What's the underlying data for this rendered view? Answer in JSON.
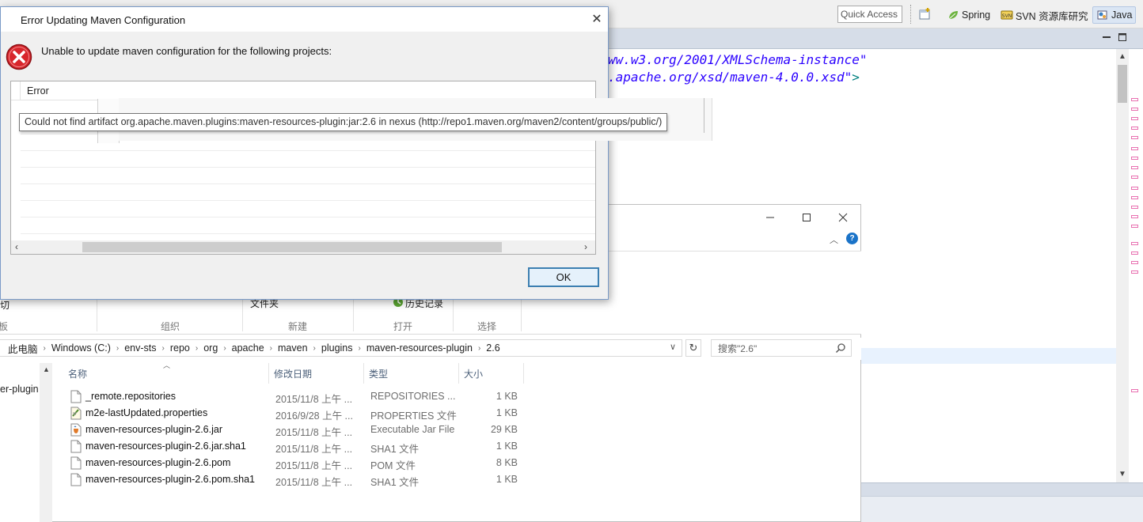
{
  "eclipse": {
    "quick_access": "Quick Access",
    "perspectives": [
      {
        "label": "Spring",
        "icon": "spring-leaf-icon"
      },
      {
        "label": "SVN 资源库研究",
        "icon": "svn-icon"
      },
      {
        "label": "Java",
        "icon": "java-icon",
        "active": true
      }
    ],
    "code_lines": [
      {
        "text": "ww.w3.org/2001/XMLSchema-instance\""
      },
      {
        "text": ".apache.org/xsd/maven-4.0.0.xsd\"",
        "bracket": ">"
      }
    ],
    "colors": {
      "code_string": "#2a00ff",
      "marker": "#e86fb0",
      "accent": "#1a73c8"
    }
  },
  "explorer": {
    "ribbon": {
      "partial_labels": [
        "剪切",
        "文件夹",
        "历史记录"
      ],
      "group_captions": [
        "板",
        "组织",
        "新建",
        "打开",
        "选择"
      ]
    },
    "address_crumbs": [
      "此电脑",
      "Windows (C:)",
      "env-sts",
      "repo",
      "org",
      "apache",
      "maven",
      "plugins",
      "maven-resources-plugin",
      "2.6"
    ],
    "search_placeholder": "搜索\"2.6\"",
    "nav_item": "er-plugin",
    "columns": {
      "name": "名称",
      "date": "修改日期",
      "type": "类型",
      "size": "大小"
    },
    "files": [
      {
        "name": "_remote.repositories",
        "date": "2015/11/8 上午 ...",
        "type": "REPOSITORIES ...",
        "size": "1 KB",
        "icon": "file-icon"
      },
      {
        "name": "m2e-lastUpdated.properties",
        "date": "2016/9/28 上午 ...",
        "type": "PROPERTIES 文件",
        "size": "1 KB",
        "icon": "properties-file-icon"
      },
      {
        "name": "maven-resources-plugin-2.6.jar",
        "date": "2015/11/8 上午 ...",
        "type": "Executable Jar File",
        "size": "29 KB",
        "icon": "jar-file-icon"
      },
      {
        "name": "maven-resources-plugin-2.6.jar.sha1",
        "date": "2015/11/8 上午 ...",
        "type": "SHA1 文件",
        "size": "1 KB",
        "icon": "file-icon"
      },
      {
        "name": "maven-resources-plugin-2.6.pom",
        "date": "2015/11/8 上午 ...",
        "type": "POM 文件",
        "size": "8 KB",
        "icon": "file-icon"
      },
      {
        "name": "maven-resources-plugin-2.6.pom.sha1",
        "date": "2015/11/8 上午 ...",
        "type": "SHA1 文件",
        "size": "1 KB",
        "icon": "file-icon"
      }
    ]
  },
  "dialog": {
    "title": "Error Updating Maven Configuration",
    "message": "Unable to update maven configuration for the following projects:",
    "table_header": "Error",
    "tooltip": "Could not find artifact org.apache.maven.plugins:maven-resources-plugin:jar:2.6 in nexus (http://repo1.maven.org/maven2/content/groups/public/)",
    "ok_label": "OK"
  }
}
